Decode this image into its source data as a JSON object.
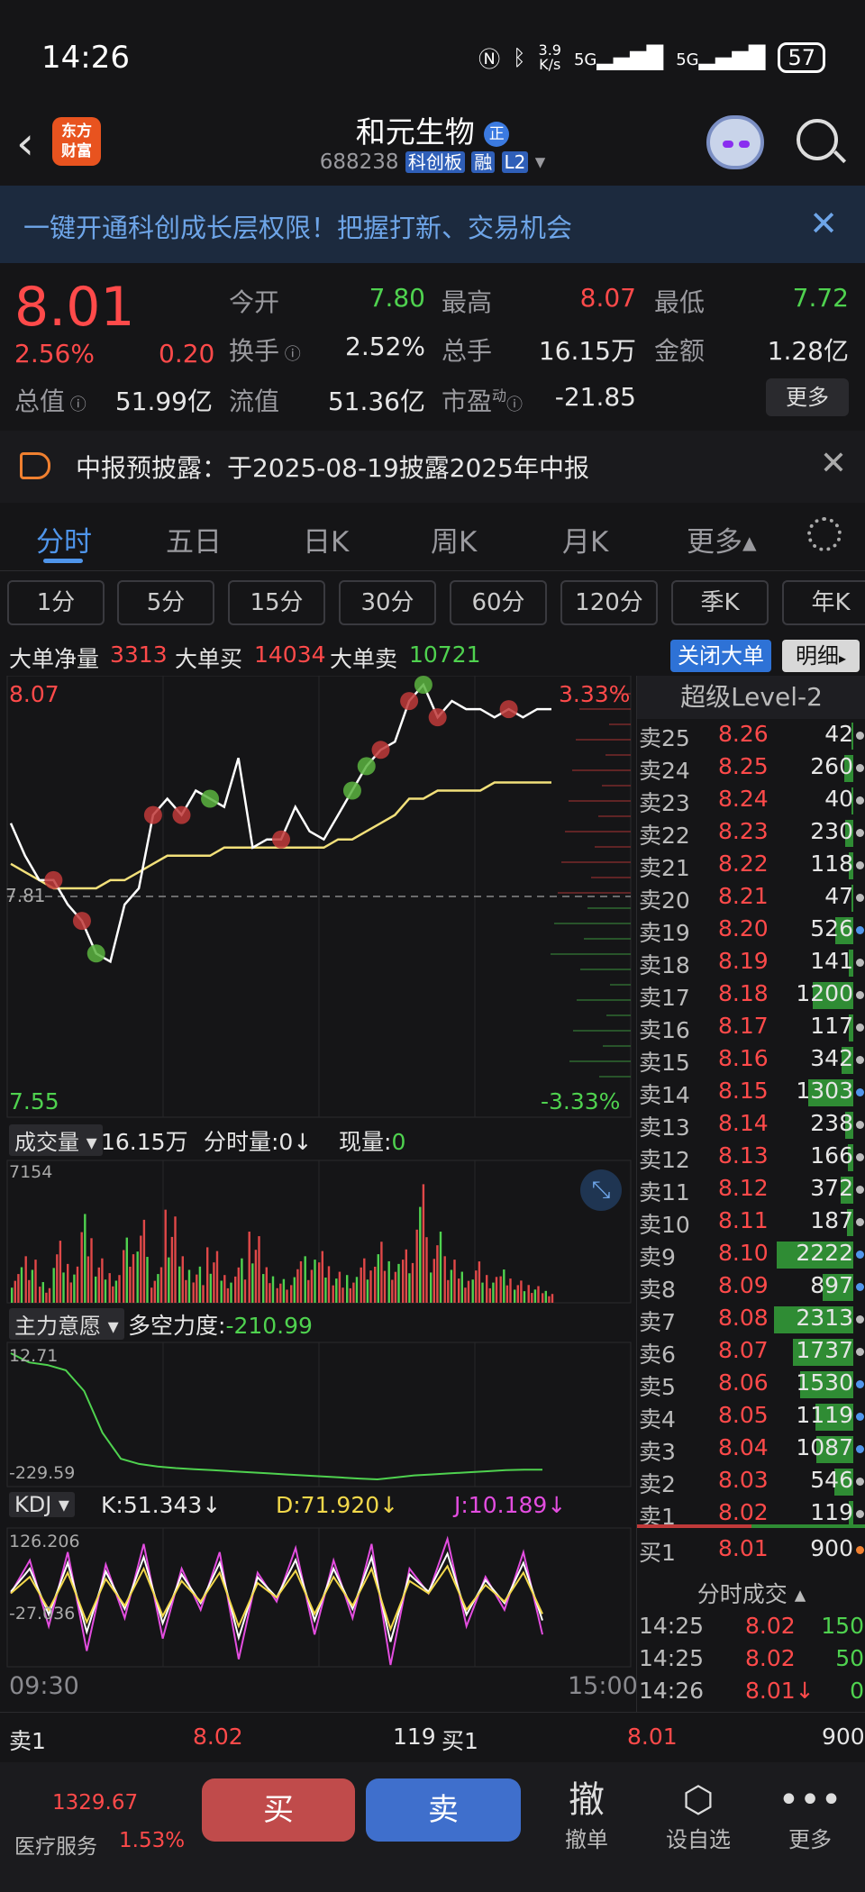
{
  "status_bar": {
    "time": "14:26",
    "speed": "3.9",
    "speed_unit": "K/s",
    "net1": "5G",
    "net2": "5G",
    "battery": "57"
  },
  "header": {
    "stock_name": "和元生物",
    "stock_code": "688238",
    "board_tag": "科创板",
    "margin_tag": "融",
    "level_tag": "L2",
    "logo_text": "东方财富"
  },
  "promo": {
    "text": "一键开通科创成长层权限！把握打新、交易机会"
  },
  "quote": {
    "price": "8.01",
    "change_pct": "2.56%",
    "change": "0.20",
    "open_label": "今开",
    "open": "7.80",
    "high_label": "最高",
    "high": "8.07",
    "low_label": "最低",
    "low": "7.72",
    "turnover_label": "换手",
    "turnover": "2.52%",
    "volume_label": "总手",
    "volume": "16.15万",
    "amount_label": "金额",
    "amount": "1.28亿",
    "mktcap_label": "总值",
    "mktcap": "51.99亿",
    "float_label": "流值",
    "float_cap": "51.36亿",
    "pe_label": "市盈",
    "pe_sup": "动",
    "pe": "-21.85",
    "more_label": "更多"
  },
  "notice": {
    "text": "中报预披露：于2025-08-19披露2025年中报"
  },
  "tabs": [
    {
      "label": "分时"
    },
    {
      "label": "五日"
    },
    {
      "label": "日K"
    },
    {
      "label": "周K"
    },
    {
      "label": "月K"
    },
    {
      "label": "更多▴"
    }
  ],
  "periods": [
    {
      "label": "1分"
    },
    {
      "label": "5分"
    },
    {
      "label": "15分"
    },
    {
      "label": "30分"
    },
    {
      "label": "60分"
    },
    {
      "label": "120分"
    },
    {
      "label": "季K"
    },
    {
      "label": "年K"
    }
  ],
  "big_order": {
    "net_label": "大单净量",
    "net": "3313",
    "buy_label": "大单买",
    "buy": "14034",
    "sell_label": "大单卖",
    "sell": "10721",
    "close_label": "关闭大单",
    "detail_label": "明细"
  },
  "chart_panels": {
    "price_top": "8.07",
    "price_bottom": "7.55",
    "pct_top": "3.33%",
    "pct_bottom": "-3.33%",
    "mid_price": "7.81",
    "vol_selector": "成交量",
    "vol_total": "16.15万",
    "vol_tick_label": "分时量:0↓",
    "vol_now_label": "现量:",
    "vol_now": "0",
    "vol_max": "7154",
    "ind_selector": "主力意愿",
    "ind_label": "多空力度:",
    "ind_value": "-210.99",
    "ind_top": "12.71",
    "ind_bottom": "-229.59",
    "kdj_selector": "KDJ",
    "k": "K:51.343↓",
    "d": "D:71.920↓",
    "j": "J:10.189↓",
    "kdj_top": "126.206",
    "kdj_bottom": "-27.036",
    "time_start": "09:30",
    "time_end": "15:00"
  },
  "chart_data": {
    "type": "line",
    "title": "",
    "xlabel": "",
    "ylabel": "",
    "ylim": [
      7.55,
      8.07
    ],
    "series": [
      {
        "values": [
          7.9,
          7.86,
          7.83,
          7.83,
          7.8,
          7.78,
          7.74,
          7.73,
          7.8,
          7.82,
          7.91,
          7.93,
          7.91,
          7.94,
          7.93,
          7.92,
          7.98,
          7.87,
          7.88,
          7.88,
          7.92,
          7.89,
          7.88,
          7.91,
          7.94,
          7.97,
          7.99,
          8.0,
          8.05,
          8.07,
          8.03,
          8.05,
          8.04,
          8.04,
          8.03,
          8.04,
          8.03,
          8.04,
          8.04
        ]
      },
      {
        "values": [
          7.85,
          7.84,
          7.83,
          7.82,
          7.82,
          7.82,
          7.82,
          7.83,
          7.83,
          7.84,
          7.85,
          7.86,
          7.86,
          7.86,
          7.86,
          7.87,
          7.87,
          7.87,
          7.87,
          7.87,
          7.87,
          7.87,
          7.87,
          7.88,
          7.88,
          7.89,
          7.9,
          7.91,
          7.93,
          7.93,
          7.94,
          7.94,
          7.94,
          7.94,
          7.95,
          7.95,
          7.95,
          7.95,
          7.95
        ]
      }
    ],
    "volume": [
      30,
      45,
      20,
      60,
      35,
      80,
      40,
      25,
      55,
      70,
      30,
      90,
      45,
      35,
      50,
      25,
      40,
      60,
      30,
      20,
      35,
      45,
      50,
      30,
      25,
      40,
      55,
      35,
      45,
      100,
      60,
      45,
      30,
      40,
      25,
      30,
      20,
      15,
      10
    ],
    "indicator": [
      12.71,
      -5,
      -10,
      -20,
      -60,
      -140,
      -190,
      -200,
      -205,
      -208,
      -210,
      -212,
      -214,
      -216,
      -218,
      -220,
      -222,
      -224,
      -226,
      -228,
      -229.59,
      -226,
      -222,
      -220,
      -218,
      -216,
      -214,
      -212,
      -211,
      -210.99
    ],
    "kdj": [
      60,
      100,
      20,
      110,
      -10,
      95,
      30,
      120,
      5,
      90,
      40,
      110,
      -20,
      85,
      50,
      115,
      10,
      100,
      30,
      120,
      -27,
      90,
      60,
      126,
      20,
      80,
      40,
      110,
      10
    ]
  },
  "order_book": {
    "title": "超级Level-2",
    "asks": [
      {
        "name": "卖25",
        "price": "8.26",
        "vol": "42",
        "fill": 0.02,
        "dot": "#bbbbbb"
      },
      {
        "name": "卖24",
        "price": "8.25",
        "vol": "260",
        "fill": 0.11,
        "dot": "#bbbbbb"
      },
      {
        "name": "卖23",
        "price": "8.24",
        "vol": "40",
        "fill": 0.02,
        "dot": "#bbbbbb"
      },
      {
        "name": "卖22",
        "price": "8.23",
        "vol": "230",
        "fill": 0.1,
        "dot": "#bbbbbb"
      },
      {
        "name": "卖21",
        "price": "8.22",
        "vol": "118",
        "fill": 0.05,
        "dot": "#bbbbbb"
      },
      {
        "name": "卖20",
        "price": "8.21",
        "vol": "47",
        "fill": 0.02,
        "dot": "#bbbbbb"
      },
      {
        "name": "卖19",
        "price": "8.20",
        "vol": "526",
        "fill": 0.22,
        "dot": "#4f95ea"
      },
      {
        "name": "卖18",
        "price": "8.19",
        "vol": "141",
        "fill": 0.06,
        "dot": "#bbbbbb"
      },
      {
        "name": "卖17",
        "price": "8.18",
        "vol": "1200",
        "fill": 0.5,
        "dot": "#bbbbbb"
      },
      {
        "name": "卖16",
        "price": "8.17",
        "vol": "117",
        "fill": 0.05,
        "dot": "#bbbbbb"
      },
      {
        "name": "卖15",
        "price": "8.16",
        "vol": "342",
        "fill": 0.14,
        "dot": "#bbbbbb"
      },
      {
        "name": "卖14",
        "price": "8.15",
        "vol": "1303",
        "fill": 0.55,
        "dot": "#4f95ea"
      },
      {
        "name": "卖13",
        "price": "8.14",
        "vol": "238",
        "fill": 0.1,
        "dot": "#bbbbbb"
      },
      {
        "name": "卖12",
        "price": "8.13",
        "vol": "166",
        "fill": 0.07,
        "dot": "#bbbbbb"
      },
      {
        "name": "卖11",
        "price": "8.12",
        "vol": "372",
        "fill": 0.16,
        "dot": "#bbbbbb"
      },
      {
        "name": "卖10",
        "price": "8.11",
        "vol": "187",
        "fill": 0.08,
        "dot": "#bbbbbb"
      },
      {
        "name": "卖9",
        "price": "8.10",
        "vol": "2222",
        "fill": 0.94,
        "dot": "#4f95ea"
      },
      {
        "name": "卖8",
        "price": "8.09",
        "vol": "897",
        "fill": 0.38,
        "dot": "#4f95ea"
      },
      {
        "name": "卖7",
        "price": "8.08",
        "vol": "2313",
        "fill": 0.98,
        "dot": "#bbbbbb"
      },
      {
        "name": "卖6",
        "price": "8.07",
        "vol": "1737",
        "fill": 0.74,
        "dot": "#bbbbbb"
      },
      {
        "name": "卖5",
        "price": "8.06",
        "vol": "1530",
        "fill": 0.65,
        "dot": "#4f95ea"
      },
      {
        "name": "卖4",
        "price": "8.05",
        "vol": "1119",
        "fill": 0.47,
        "dot": "#4f95ea"
      },
      {
        "name": "卖3",
        "price": "8.04",
        "vol": "1087",
        "fill": 0.46,
        "dot": "#4f95ea"
      },
      {
        "name": "卖2",
        "price": "8.03",
        "vol": "546",
        "fill": 0.23,
        "dot": "#bbbbbb"
      },
      {
        "name": "卖1",
        "price": "8.02",
        "vol": "119",
        "fill": 0.05,
        "dot": "#bbbbbb"
      }
    ],
    "bid1": {
      "name": "买1",
      "price": "8.01",
      "vol": "900"
    },
    "trades_title": "分时成交 ▴",
    "trades": [
      {
        "time": "14:25",
        "price": "8.02",
        "vol": "150"
      },
      {
        "time": "14:25",
        "price": "8.02",
        "vol": "50"
      },
      {
        "time": "14:26",
        "price": "8.01↓",
        "vol": "0"
      }
    ]
  },
  "strip": {
    "ask_label": "卖1",
    "ask_price": "8.02",
    "ask_vol": "119",
    "bid_label": "买1",
    "bid_price": "8.01",
    "bid_vol": "900"
  },
  "bottom_bar": {
    "index_value": "1329.67",
    "index_name": "医疗服务",
    "index_pct": "1.53%",
    "buy": "买",
    "sell": "卖",
    "cancel_icon": "撤",
    "cancel_label": "撤单",
    "watch_label": "设自选",
    "more_label": "更多"
  }
}
